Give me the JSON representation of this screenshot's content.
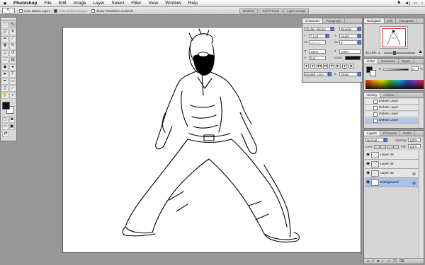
{
  "menubar": {
    "apple": "",
    "app": "Photoshop",
    "items": [
      "File",
      "Edit",
      "Image",
      "Layer",
      "Select",
      "Filter",
      "View",
      "Window",
      "Help"
    ],
    "status_icons": [
      "flag-icon",
      "speaker-icon",
      "battery-icon",
      "search-icon"
    ]
  },
  "options": {
    "tool_glyph": "↖",
    "auto_select_layer": "Auto Select Layer",
    "auto_select_groups": "Auto Select Groups",
    "show_transform": "Show Transform Controls"
  },
  "wells": [
    "Brushes",
    "Tool Presets",
    "Layer Comps"
  ],
  "character": {
    "tabs": [
      "Character",
      "Paragraph"
    ],
    "font": "Shelley Allegro Scr...",
    "style": "Regular",
    "size": "7.2 pt",
    "leading": "(Auto)",
    "kerning": "Metrics",
    "tracking": "0",
    "vscale": "100%",
    "hscale": "100%",
    "baseline": "0 pt",
    "color_label": "Color:",
    "style_buttons": [
      "T",
      "T",
      "TT",
      "Tt",
      "T¹",
      "T₁",
      "T",
      "T"
    ],
    "language": "English: USA",
    "aa": "Sharp"
  },
  "navigator": {
    "tabs": [
      "Navigator",
      "Info",
      "Histogram"
    ],
    "zoom": "31.15%"
  },
  "color": {
    "tabs": [
      "Color",
      "Swatches",
      "Styles"
    ],
    "k_label": "K",
    "k_value": "0",
    "pct": "%"
  },
  "history": {
    "tabs": [
      "History",
      "Actions"
    ],
    "items": [
      "Delete Layer",
      "Delete Layer",
      "Delete Layer",
      "Delete Layer"
    ]
  },
  "layers": {
    "tabs": [
      "Layers",
      "Channels",
      "Paths"
    ],
    "blend": "Normal",
    "opacity_label": "Opacity:",
    "opacity": "100%",
    "lock_label": "Lock:",
    "fill_label": "Fill:",
    "fill": "100%",
    "items": [
      {
        "name": "Layer 45"
      },
      {
        "name": "Layer 44"
      },
      {
        "name": "Layer 43"
      },
      {
        "name": "Background"
      }
    ]
  },
  "colors": {
    "menubar_bg": "#eeeeee",
    "workspace": "#979797",
    "selection": "#a9c0e9",
    "foreground": "#111111",
    "background": "#ffffff"
  }
}
